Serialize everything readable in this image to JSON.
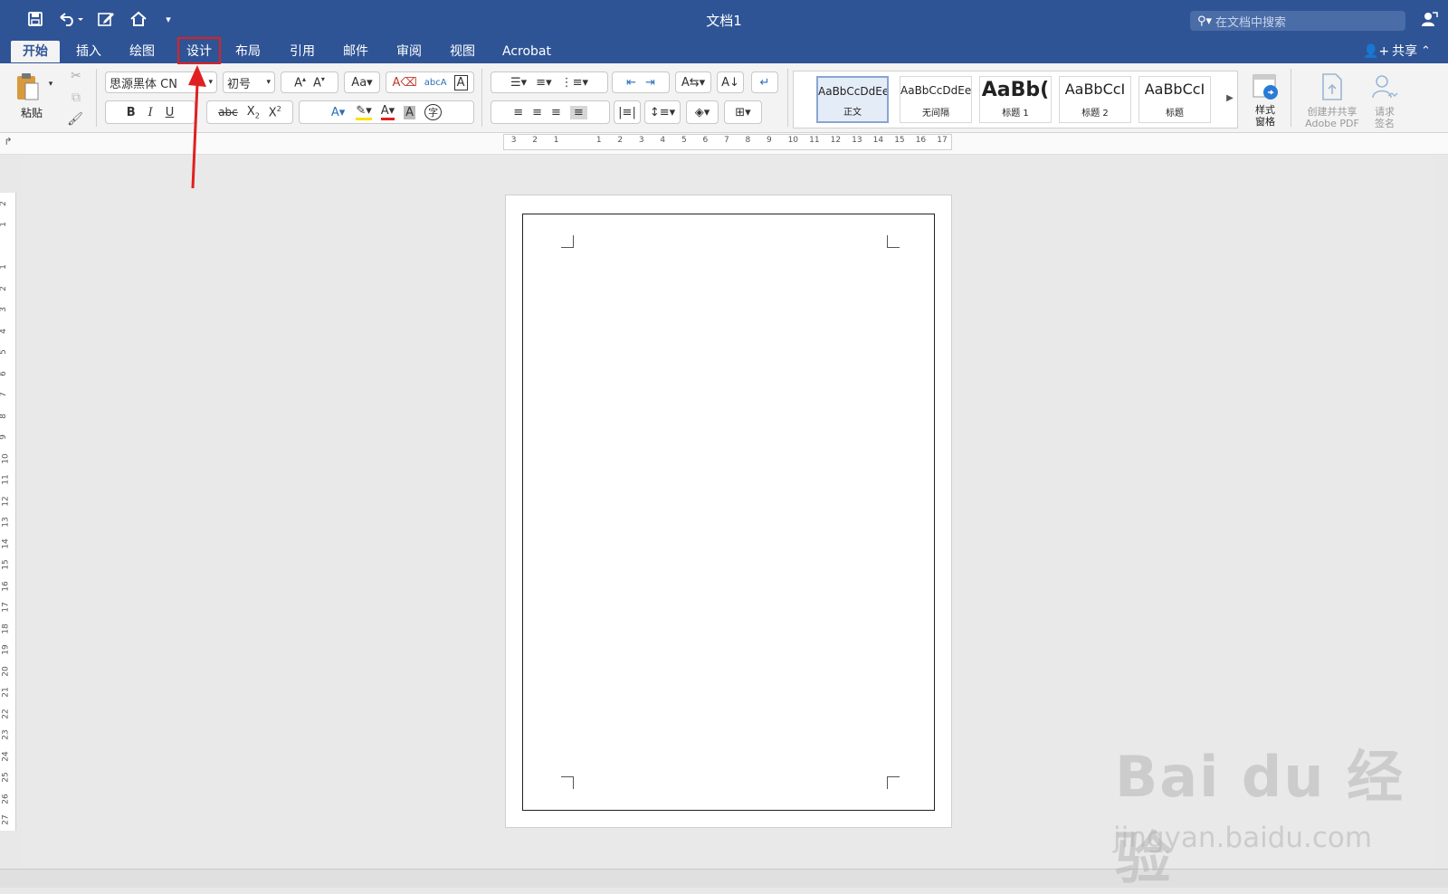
{
  "window": {
    "title": "文档1",
    "search_placeholder": "在文档中搜索"
  },
  "tabs": [
    {
      "label": "开始",
      "active": true
    },
    {
      "label": "插入"
    },
    {
      "label": "绘图"
    },
    {
      "label": "设计",
      "highlighted": true
    },
    {
      "label": "布局"
    },
    {
      "label": "引用"
    },
    {
      "label": "邮件"
    },
    {
      "label": "审阅"
    },
    {
      "label": "视图"
    },
    {
      "label": "Acrobat"
    }
  ],
  "share_label": "共享",
  "ribbon": {
    "paste_label": "粘贴",
    "font_name": "思源黑体 CN",
    "font_size": "初号",
    "styles": [
      {
        "sample": "AaBbCcDdEe",
        "label": "正文",
        "selected": true
      },
      {
        "sample": "AaBbCcDdEe",
        "label": "无间隔"
      },
      {
        "sample": "AaBb(",
        "label": "标题 1"
      },
      {
        "sample": "AaBbCcI",
        "label": "标题 2"
      },
      {
        "sample": "AaBbCcI",
        "label": "标题"
      }
    ],
    "styles_pane_label": "样式\n窗格",
    "create_pdf_label_1": "创建并共享",
    "create_pdf_label_2": "Adobe PDF",
    "request_sign_label_1": "请求",
    "request_sign_label_2": "签名"
  },
  "ruler_h_ticks": [
    "3",
    "2",
    "1",
    "",
    "1",
    "2",
    "3",
    "4",
    "5",
    "6",
    "7",
    "8",
    "9",
    "10",
    "11",
    "12",
    "13",
    "14",
    "15",
    "16",
    "17"
  ],
  "ruler_v_ticks": [
    "2",
    "1",
    "",
    "1",
    "2",
    "3",
    "4",
    "5",
    "6",
    "7",
    "8",
    "9",
    "10",
    "11",
    "12",
    "13",
    "14",
    "15",
    "16",
    "17",
    "18",
    "19",
    "20",
    "21",
    "22",
    "23",
    "24",
    "25",
    "26",
    "27"
  ],
  "watermark": {
    "brand": "Bai du 经验",
    "url": "jingyan.baidu.com"
  },
  "colors": {
    "accent": "#2f5496",
    "highlight": "#e02020"
  }
}
